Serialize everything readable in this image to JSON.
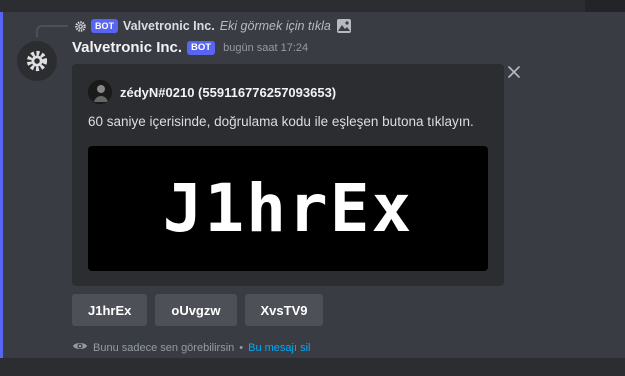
{
  "reply": {
    "bot_tag": "BOT",
    "author": "Valvetronic Inc.",
    "text": "Eki görmek için tıkla",
    "avatar_icon": "gear-icon",
    "attachment_icon": "image-icon"
  },
  "message": {
    "author": "Valvetronic Inc.",
    "bot_tag": "BOT",
    "timestamp": "bugün saat 17:24",
    "avatar_icon": "gear-icon",
    "dismiss_icon": "close-icon"
  },
  "embed": {
    "author_name": "zédyN#0210 (559116776257093653)",
    "description": "60 saniye içerisinde, doğrulama kodu ile eşleşen butona tıklayın.",
    "captcha_text": "J1hrEx"
  },
  "buttons": [
    {
      "label": "J1hrEx"
    },
    {
      "label": "oUvgzw"
    },
    {
      "label": "XvsTV9"
    }
  ],
  "ephemeral": {
    "note": "Bunu sadece sen görebilirsin",
    "separator": "•",
    "dismiss_link": "Bu mesajı sil",
    "eye_icon": "eye-icon"
  },
  "colors": {
    "background": "#313338",
    "embed_background": "#2b2d31",
    "bot_tag": "#5865f2",
    "button": "#4e5058",
    "link": "#00a8fc"
  }
}
